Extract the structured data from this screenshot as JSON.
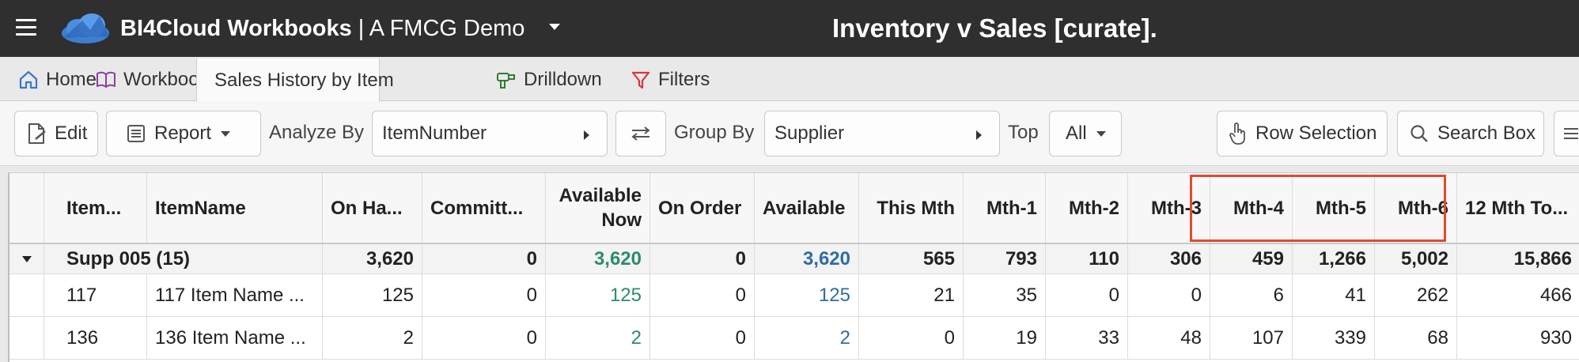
{
  "app": {
    "brand_bold": "BI4Cloud Workbooks",
    "brand_rest": "| A FMCG Demo",
    "page_title": "Inventory v Sales [curate]."
  },
  "tabs": [
    {
      "label": "Home",
      "icon": "home-icon"
    },
    {
      "label": "Workbook",
      "icon": "book-icon"
    },
    {
      "label": "Sales History by Item",
      "icon": "list-icon",
      "active": true
    },
    {
      "label": "Drilldown",
      "icon": "drill-icon"
    },
    {
      "label": "Filters",
      "icon": "filter-icon"
    }
  ],
  "toolbar": {
    "edit_label": "Edit",
    "report_label": "Report",
    "analyze_by_label": "Analyze By",
    "analyze_by_value": "ItemNumber",
    "group_by_label": "Group By",
    "group_by_value": "Supplier",
    "top_label": "Top",
    "top_value": "All",
    "row_selection_label": "Row Selection",
    "search_box_label": "Search Box"
  },
  "grid": {
    "columns": [
      "Item...",
      "ItemName",
      "On Ha...",
      "Committ...",
      "Available Now",
      "On Order",
      "Available",
      "This Mth",
      "Mth-1",
      "Mth-2",
      "Mth-3",
      "Mth-4",
      "Mth-5",
      "Mth-6",
      "12 Mth To..."
    ],
    "group_row": {
      "label": "Supp 005 (15)",
      "values": [
        "3,620",
        "0",
        "3,620",
        "0",
        "3,620",
        "565",
        "793",
        "110",
        "306",
        "459",
        "1,266",
        "5,002",
        "15,866"
      ]
    },
    "rows": [
      {
        "item": "117",
        "name": "117 Item Name ...",
        "values": [
          "125",
          "0",
          "125",
          "0",
          "125",
          "21",
          "35",
          "0",
          "0",
          "6",
          "41",
          "262",
          "466"
        ]
      },
      {
        "item": "136",
        "name": "136 Item Name ...",
        "values": [
          "2",
          "0",
          "2",
          "0",
          "2",
          "0",
          "19",
          "33",
          "48",
          "107",
          "339",
          "68",
          "930"
        ]
      }
    ]
  },
  "colors": {
    "topbar": "#2f2f2f",
    "available_now": "#2e8b6b",
    "available": "#2e6da4",
    "highlight": "#e04a2f"
  }
}
